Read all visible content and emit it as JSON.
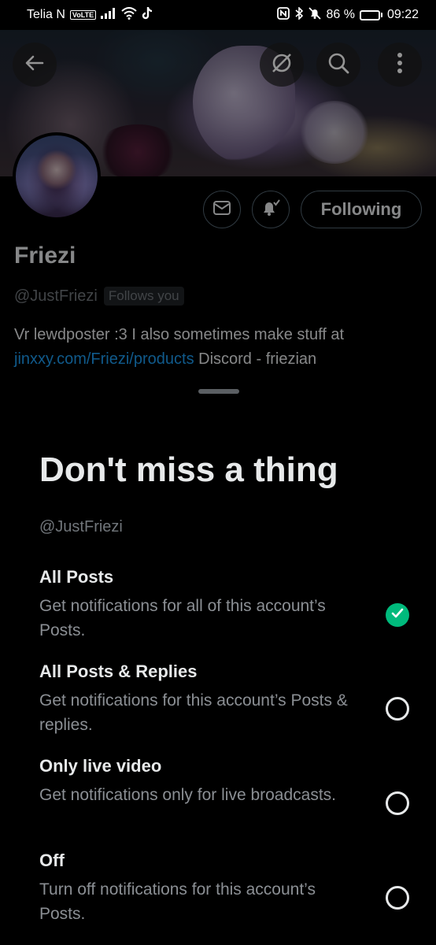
{
  "status_bar": {
    "carrier": "Telia N",
    "volte": "VoLTE",
    "battery_percent": "86 %",
    "battery_level": 0.86,
    "time": "09:22"
  },
  "profile": {
    "name": "Friezi",
    "handle": "@JustFriezi",
    "follows_you": "Follows you",
    "bio_text": "Vr lewdposter :3 I also sometimes make stuff at",
    "bio_link": "jinxxy.com/Friezi/products",
    "bio_suffix": "Discord - friezian",
    "following_label": "Following"
  },
  "sheet": {
    "title": "Don't miss a thing",
    "handle": "@JustFriezi",
    "options": [
      {
        "title": "All Posts",
        "desc": "Get notifications for all of this account’s Posts.",
        "selected": true
      },
      {
        "title": "All Posts & Replies",
        "desc": "Get notifications for this account’s Posts & replies.",
        "selected": false
      },
      {
        "title": "Only live video",
        "desc": "Get notifications only for live broadcasts.",
        "selected": false
      },
      {
        "title": "Off",
        "desc": "Turn off notifications for this account’s Posts.",
        "selected": false
      }
    ]
  },
  "colors": {
    "accent_green": "#00ba7c",
    "link_blue": "#1d9bf0",
    "background": "#000000"
  }
}
